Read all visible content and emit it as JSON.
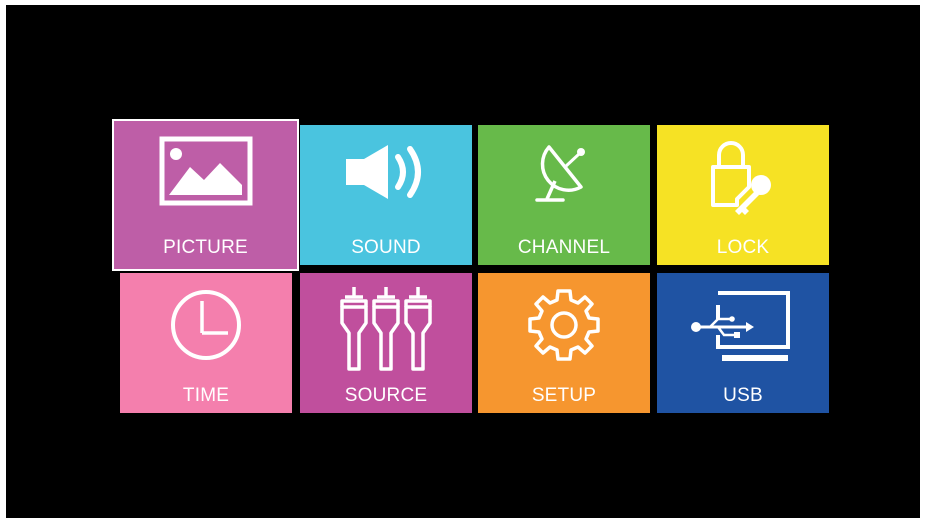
{
  "menu": {
    "tiles": [
      {
        "label": "PICTURE",
        "icon": "picture-icon",
        "color": "#be5ea7",
        "selected": true
      },
      {
        "label": "SOUND",
        "icon": "speaker-icon",
        "color": "#4ac4df",
        "selected": false
      },
      {
        "label": "CHANNEL",
        "icon": "satellite-dish-icon",
        "color": "#67ba4a",
        "selected": false
      },
      {
        "label": "LOCK",
        "icon": "lock-key-icon",
        "color": "#f6e224",
        "selected": false
      },
      {
        "label": "TIME",
        "icon": "clock-icon",
        "color": "#f47fad",
        "selected": false
      },
      {
        "label": "SOURCE",
        "icon": "rca-connectors-icon",
        "color": "#c04f9d",
        "selected": false
      },
      {
        "label": "SETUP",
        "icon": "gear-icon",
        "color": "#f6962f",
        "selected": false
      },
      {
        "label": "USB",
        "icon": "usb-icon",
        "color": "#1f53a3",
        "selected": false
      }
    ]
  }
}
